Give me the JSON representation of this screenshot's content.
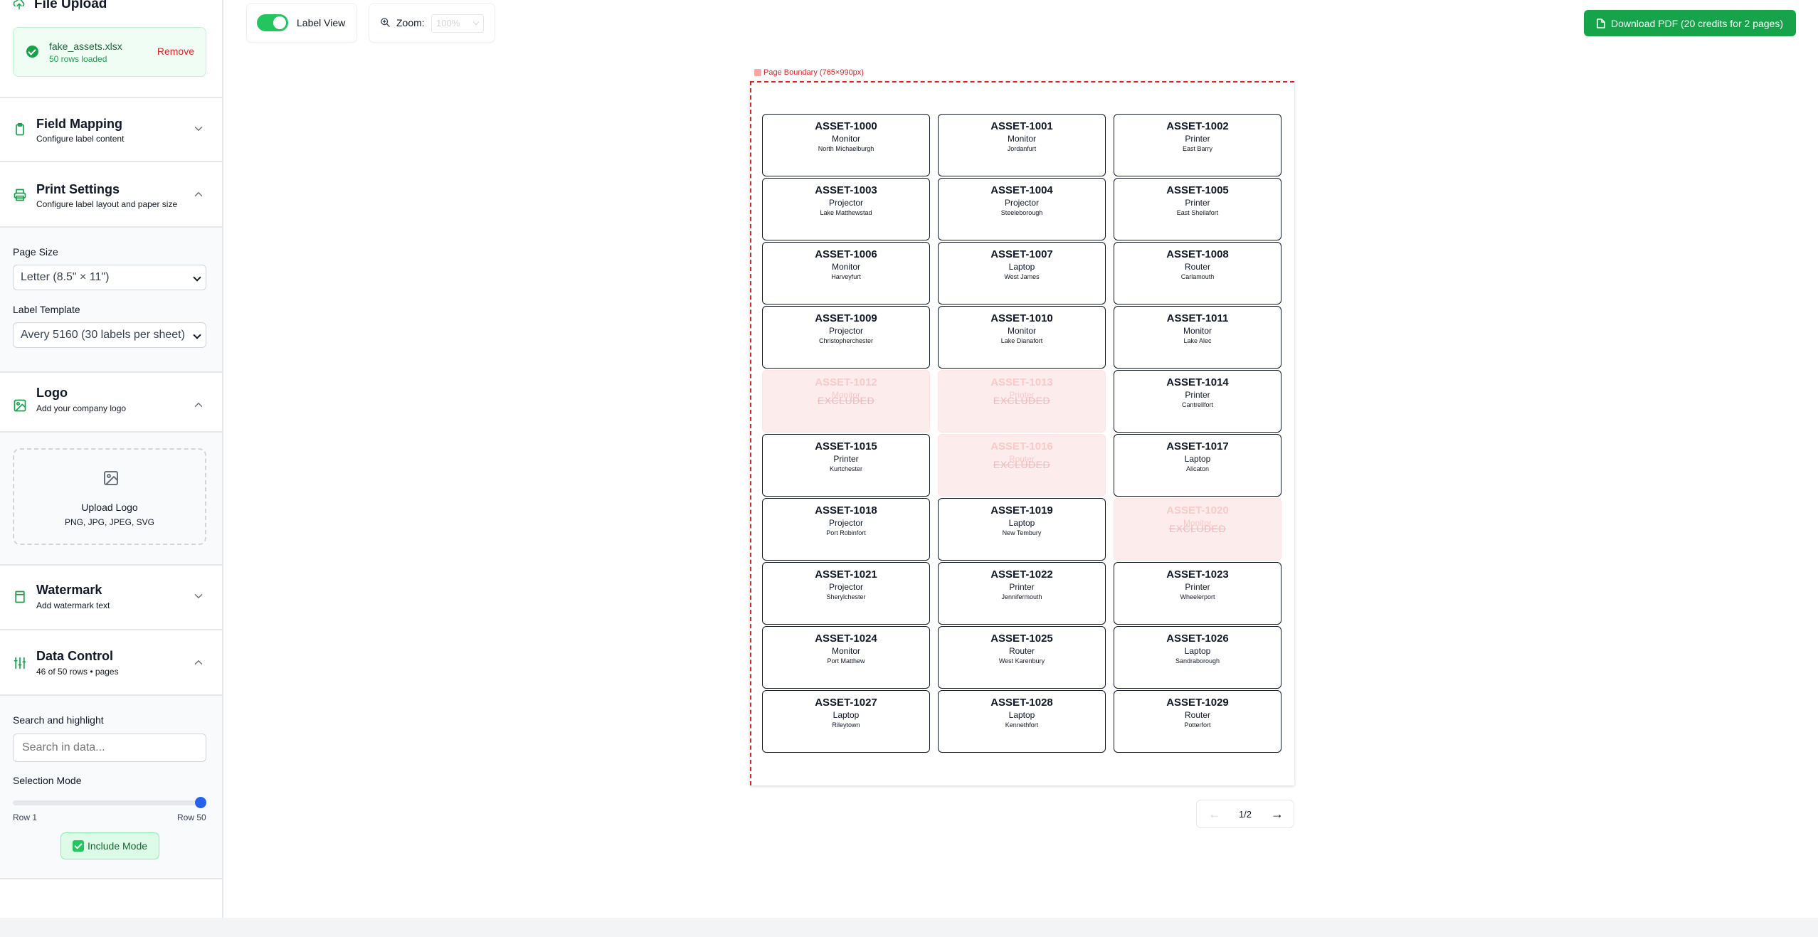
{
  "sidebar": {
    "file_upload": {
      "title": "File Upload",
      "file_name": "fake_assets.xlsx",
      "rows_loaded": "50 rows loaded",
      "remove_label": "Remove"
    },
    "field_mapping": {
      "title": "Field Mapping",
      "subtitle": "Configure label content"
    },
    "print_settings": {
      "title": "Print Settings",
      "subtitle": "Configure label layout and paper size",
      "page_size_label": "Page Size",
      "page_size_value": "Letter (8.5\" × 11\")",
      "template_label": "Label Template",
      "template_value": "Avery 5160 (30 labels per sheet)"
    },
    "logo": {
      "title": "Logo",
      "subtitle": "Add your company logo",
      "upload_label": "Upload Logo",
      "formats": "PNG, JPG, JPEG, SVG"
    },
    "watermark": {
      "title": "Watermark",
      "subtitle": "Add watermark text"
    },
    "data_control": {
      "title": "Data Control",
      "subtitle": "46 of 50 rows • pages",
      "search_label": "Search and highlight",
      "search_placeholder": "Search in data...",
      "selection_label": "Selection Mode",
      "range_min": "Row 1",
      "range_max": "Row 50",
      "slider_value": 50,
      "mode_button": "Include Mode"
    }
  },
  "toolbar": {
    "label_view": "Label View",
    "label_view_on": true,
    "zoom_label": "Zoom:",
    "zoom_value": "100%",
    "download_label": "Download PDF (20 credits for 2 pages)"
  },
  "preview": {
    "boundary_label": "Page Boundary (765×990px)",
    "excluded_text": "EXCLUDED",
    "labels": [
      {
        "id": "ASSET-1000",
        "type": "Monitor",
        "location": "North Michaelburgh",
        "excluded": false
      },
      {
        "id": "ASSET-1001",
        "type": "Monitor",
        "location": "Jordanfurt",
        "excluded": false
      },
      {
        "id": "ASSET-1002",
        "type": "Printer",
        "location": "East Barry",
        "excluded": false
      },
      {
        "id": "ASSET-1003",
        "type": "Projector",
        "location": "Lake Matthewstad",
        "excluded": false
      },
      {
        "id": "ASSET-1004",
        "type": "Projector",
        "location": "Steeleborough",
        "excluded": false
      },
      {
        "id": "ASSET-1005",
        "type": "Printer",
        "location": "East Sheilafort",
        "excluded": false
      },
      {
        "id": "ASSET-1006",
        "type": "Monitor",
        "location": "Harveyfurt",
        "excluded": false
      },
      {
        "id": "ASSET-1007",
        "type": "Laptop",
        "location": "West James",
        "excluded": false
      },
      {
        "id": "ASSET-1008",
        "type": "Router",
        "location": "Carlamouth",
        "excluded": false
      },
      {
        "id": "ASSET-1009",
        "type": "Projector",
        "location": "Christopherchester",
        "excluded": false
      },
      {
        "id": "ASSET-1010",
        "type": "Monitor",
        "location": "Lake Dianafort",
        "excluded": false
      },
      {
        "id": "ASSET-1011",
        "type": "Monitor",
        "location": "Lake Alec",
        "excluded": false
      },
      {
        "id": "ASSET-1012",
        "type": "Monitor",
        "location": "",
        "excluded": true
      },
      {
        "id": "ASSET-1013",
        "type": "Printer",
        "location": "",
        "excluded": true
      },
      {
        "id": "ASSET-1014",
        "type": "Printer",
        "location": "Cantrellfort",
        "excluded": false
      },
      {
        "id": "ASSET-1015",
        "type": "Printer",
        "location": "Kurtchester",
        "excluded": false
      },
      {
        "id": "ASSET-1016",
        "type": "Router",
        "location": "",
        "excluded": true
      },
      {
        "id": "ASSET-1017",
        "type": "Laptop",
        "location": "Alicaton",
        "excluded": false
      },
      {
        "id": "ASSET-1018",
        "type": "Projector",
        "location": "Port Robinfort",
        "excluded": false
      },
      {
        "id": "ASSET-1019",
        "type": "Laptop",
        "location": "New Tembury",
        "excluded": false
      },
      {
        "id": "ASSET-1020",
        "type": "Monitor",
        "location": "",
        "excluded": true
      },
      {
        "id": "ASSET-1021",
        "type": "Projector",
        "location": "Sherylchester",
        "excluded": false
      },
      {
        "id": "ASSET-1022",
        "type": "Printer",
        "location": "Jennifermouth",
        "excluded": false
      },
      {
        "id": "ASSET-1023",
        "type": "Printer",
        "location": "Wheelerport",
        "excluded": false
      },
      {
        "id": "ASSET-1024",
        "type": "Monitor",
        "location": "Port Matthew",
        "excluded": false
      },
      {
        "id": "ASSET-1025",
        "type": "Router",
        "location": "West Karenbury",
        "excluded": false
      },
      {
        "id": "ASSET-1026",
        "type": "Laptop",
        "location": "Sandraborough",
        "excluded": false
      },
      {
        "id": "ASSET-1027",
        "type": "Laptop",
        "location": "Rileytown",
        "excluded": false
      },
      {
        "id": "ASSET-1028",
        "type": "Laptop",
        "location": "Kennethfort",
        "excluded": false
      },
      {
        "id": "ASSET-1029",
        "type": "Router",
        "location": "Potterfort",
        "excluded": false
      }
    ],
    "pager": {
      "prev": "←",
      "page": "1/2",
      "next": "→"
    }
  },
  "colors": {
    "accent_green": "#16a34a",
    "excluded_bg": "#fdecec",
    "boundary_red": "#dc2626",
    "slider_blue": "#2563eb"
  },
  "icons": [
    "upload-icon",
    "check-circle-icon",
    "clipboard-icon",
    "printer-icon",
    "image-icon",
    "bookmark-icon",
    "sliders-icon",
    "chevron-down-icon",
    "chevron-up-icon",
    "zoom-icon",
    "file-icon"
  ]
}
